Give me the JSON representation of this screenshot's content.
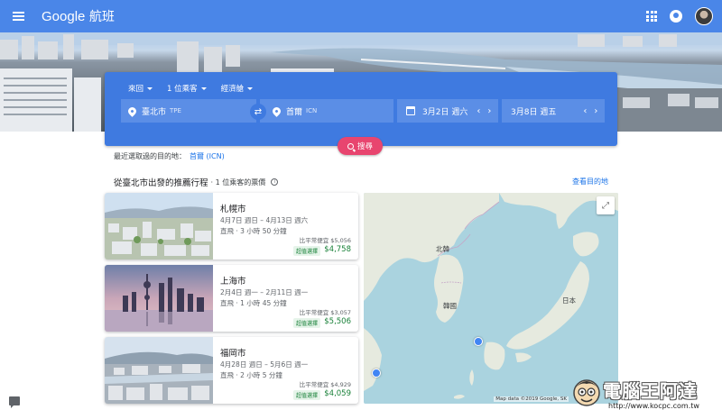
{
  "appbar": {
    "logo": "Google",
    "product": "航班"
  },
  "search": {
    "trip_type": "來回",
    "passengers": "1 位乘客",
    "cabin": "經濟艙",
    "origin_city": "臺北市",
    "origin_code": "TPE",
    "dest_city": "首爾",
    "dest_code": "ICN",
    "depart_date": "3月2日 週六",
    "return_date": "3月8日 週五",
    "search_label": "搜尋"
  },
  "recent": {
    "label": "最近選取過的目的地：",
    "link": "首爾 (ICN)"
  },
  "section": {
    "title": "從臺北市出發的推薦行程",
    "subtitle": "· 1 位乘客的票價",
    "view_link": "查看目的地"
  },
  "destinations": [
    {
      "city": "札幌市",
      "dates": "4月7日 週日 – 4月13日 週六",
      "flight": "直飛 · 3 小時 50 分鐘",
      "cheaper": "比平常便宜 $5,056",
      "badge": "超值選擇",
      "price": "$4,758"
    },
    {
      "city": "上海市",
      "dates": "2月4日 週一 – 2月11日 週一",
      "flight": "直飛 · 1 小時 45 分鐘",
      "cheaper": "比平常便宜 $3,057",
      "badge": "超值選擇",
      "price": "$5,506"
    },
    {
      "city": "福岡市",
      "dates": "4月28日 週日 – 5月6日 週一",
      "flight": "直飛 · 2 小時 5 分鐘",
      "cheaper": "比平常便宜 $4,929",
      "badge": "超值選擇",
      "price": "$4,059"
    }
  ],
  "map": {
    "label_nk": "北韓",
    "label_kr": "韓國",
    "label_jp": "日本",
    "attribution": "Map data ©2019 Google, SK"
  },
  "watermark": {
    "brand": "電腦王阿達",
    "url": "http://www.kocpc.com.tw"
  },
  "colors": {
    "appbar": "#4a86e8",
    "search_card": "#3f7ae0",
    "search_button": "#e8456f",
    "price_green": "#188038",
    "link_blue": "#1a73e8"
  }
}
